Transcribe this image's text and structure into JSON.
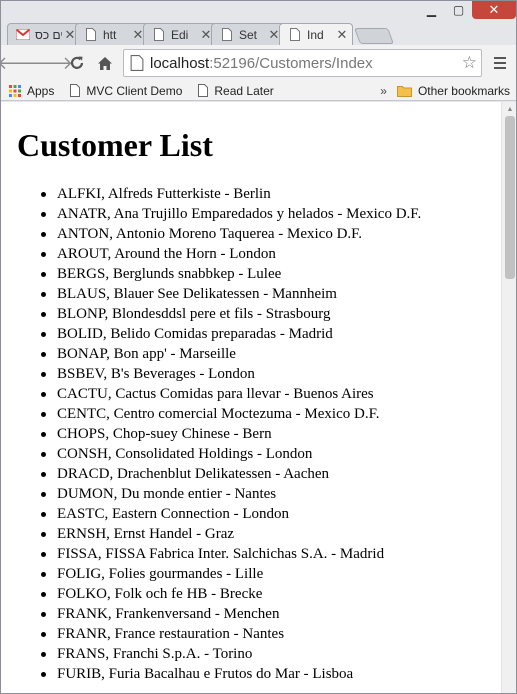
{
  "tabs": [
    {
      "label": "ים כס",
      "icon": "gmail-icon",
      "active": false
    },
    {
      "label": "htt",
      "icon": "page-icon",
      "active": false
    },
    {
      "label": "Edi",
      "icon": "page-icon",
      "active": false
    },
    {
      "label": "Set",
      "icon": "page-icon",
      "active": false
    },
    {
      "label": "Ind",
      "icon": "page-icon",
      "active": true
    }
  ],
  "toolbar": {
    "url_host": "localhost",
    "url_rest": ":52196/Customers/Index"
  },
  "bookmarks": {
    "items": [
      {
        "label": "Apps",
        "icon": "apps-icon"
      },
      {
        "label": "MVC Client Demo",
        "icon": "page-icon"
      },
      {
        "label": "Read Later",
        "icon": "page-icon"
      }
    ],
    "overflow": "»",
    "other": "Other bookmarks"
  },
  "page": {
    "title": "Customer List",
    "customers": [
      "ALFKI, Alfreds Futterkiste - Berlin",
      "ANATR, Ana Trujillo Emparedados y helados - Mexico D.F.",
      "ANTON, Antonio Moreno Taquerea - Mexico D.F.",
      "AROUT, Around the Horn - London",
      "BERGS, Berglunds snabbkep - Lulee",
      "BLAUS, Blauer See Delikatessen - Mannheim",
      "BLONP, Blondesddsl pere et fils - Strasbourg",
      "BOLID, Belido Comidas preparadas - Madrid",
      "BONAP, Bon app' - Marseille",
      "BSBEV, B's Beverages - London",
      "CACTU, Cactus Comidas para llevar - Buenos Aires",
      "CENTC, Centro comercial Moctezuma - Mexico D.F.",
      "CHOPS, Chop-suey Chinese - Bern",
      "CONSH, Consolidated Holdings - London",
      "DRACD, Drachenblut Delikatessen - Aachen",
      "DUMON, Du monde entier - Nantes",
      "EASTC, Eastern Connection - London",
      "ERNSH, Ernst Handel - Graz",
      "FISSA, FISSA Fabrica Inter. Salchichas S.A. - Madrid",
      "FOLIG, Folies gourmandes - Lille",
      "FOLKO, Folk och fe HB - Brecke",
      "FRANK, Frankenversand - Menchen",
      "FRANR, France restauration - Nantes",
      "FRANS, Franchi S.p.A. - Torino",
      "FURIB, Furia Bacalhau e Frutos do Mar - Lisboa"
    ]
  }
}
